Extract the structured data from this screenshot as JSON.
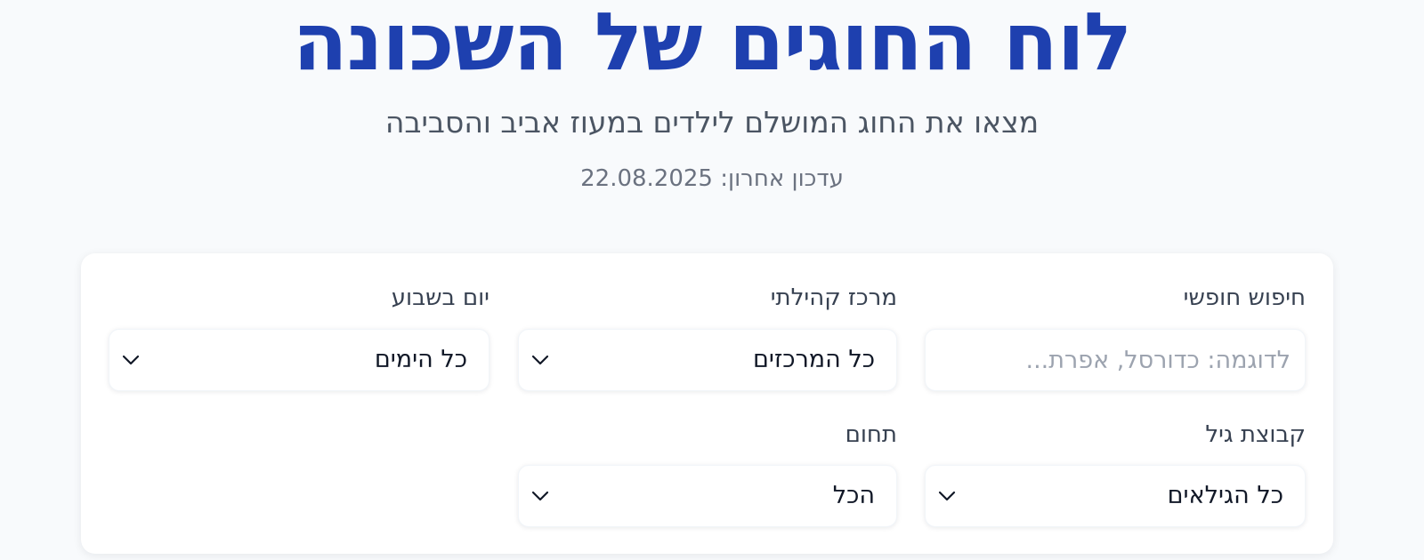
{
  "header": {
    "title": "לוח החוגים של השכונה",
    "subtitle": "מצאו את החוג המושלם לילדים במעוז אביב והסביבה",
    "last_updated": "עדכון אחרון: 22.08.2025"
  },
  "filters": {
    "search": {
      "label": "חיפוש חופשי",
      "placeholder": "לדוגמה: כדורסל, אפרת...",
      "value": ""
    },
    "community_center": {
      "label": "מרכז קהילתי",
      "selected": "כל המרכזים",
      "icon": "chevron-down-icon"
    },
    "day_of_week": {
      "label": "יום בשבוע",
      "selected": "כל הימים",
      "icon": "chevron-down-icon"
    },
    "age_group": {
      "label": "קבוצת גיל",
      "selected": "כל הגילאים",
      "icon": "chevron-down-icon"
    },
    "field": {
      "label": "תחום",
      "selected": "הכל",
      "icon": "chevron-down-icon"
    }
  },
  "colors": {
    "title": "#1e40af",
    "background": "#f8fafc",
    "card": "#ffffff"
  }
}
